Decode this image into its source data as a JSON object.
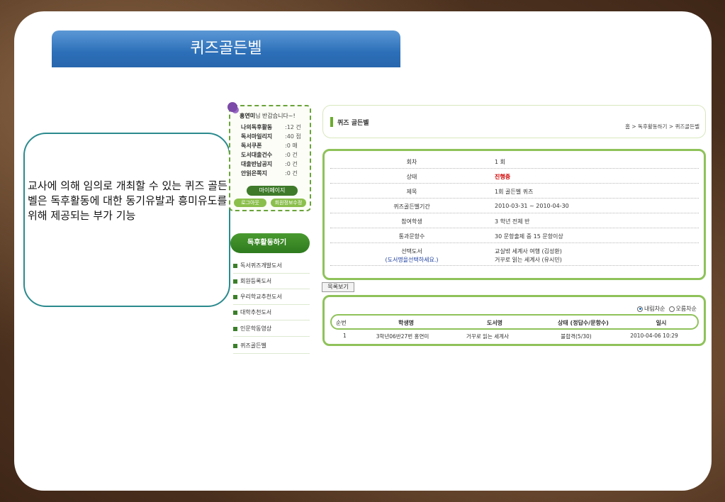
{
  "slide": {
    "title": "퀴즈골든벨",
    "callout_text": "교사에 의해 임의로 개최할 수 있는 퀴즈 골든벨은 독후활동에 대한 동기유발과 흥미유도를 위해 제공되는 부가 기능"
  },
  "login": {
    "user_name": "홍연미",
    "greeting_suffix": "님 반갑습니다~!",
    "stats": [
      {
        "label": "나의독후활동",
        "value": ":12 건"
      },
      {
        "label": "독서마일리지",
        "value": ":40 점"
      },
      {
        "label": "독서쿠폰",
        "value": ":0 매"
      },
      {
        "label": "도서대출건수",
        "value": ":0 건"
      },
      {
        "label": "대출반납공지",
        "value": ":0 건"
      },
      {
        "label": "안읽은쪽지",
        "value": ":0 건"
      }
    ],
    "mypage_label": "마이페이지",
    "logout_label": "로그아웃",
    "edit_info_label": "회원정보수정"
  },
  "menu": {
    "header": "독후활동하기",
    "items": [
      "독서퀴즈개발도서",
      "회원등록도서",
      "우리학교추천도서",
      "대학추천도서",
      "인문학동영상",
      "퀴즈골든벨"
    ]
  },
  "header": {
    "title": "퀴즈 골든벨",
    "breadcrumb": "홈 > 독후활동하기 > 퀴즈골든벨"
  },
  "info": {
    "rows": [
      {
        "label": "회차",
        "value": "1 회"
      },
      {
        "label": "상태",
        "value": "진행중"
      },
      {
        "label": "제목",
        "value": "1회 골든벨 퀴즈"
      },
      {
        "label": "퀴즈골든벨기간",
        "value": "2010-03-31 ~ 2010-04-30"
      },
      {
        "label": "참여학생",
        "value": "3 학년 전체 반"
      },
      {
        "label": "통과문항수",
        "value": "30 문항출제 중  15 문항이상"
      }
    ],
    "book_label": "선택도서",
    "book_hint": "(도서명을선택하세요.)",
    "books": [
      "교실밖 세계사 여행 (김성환)",
      "거꾸로 읽는 세계사 (유시민)"
    ]
  },
  "list_button": "목록보기",
  "results": {
    "sort_desc": "내림차순",
    "sort_asc": "오름차순",
    "columns": [
      "순번",
      "학생명",
      "도서명",
      "상태 (정답수/문항수)",
      "일시"
    ],
    "rows": [
      {
        "no": "1",
        "student": "3학년06반27번 홍연미",
        "book": "거꾸로 읽는 세계사",
        "status": "불합격(5/30)",
        "date": "2010-04-06 10:29"
      }
    ]
  }
}
